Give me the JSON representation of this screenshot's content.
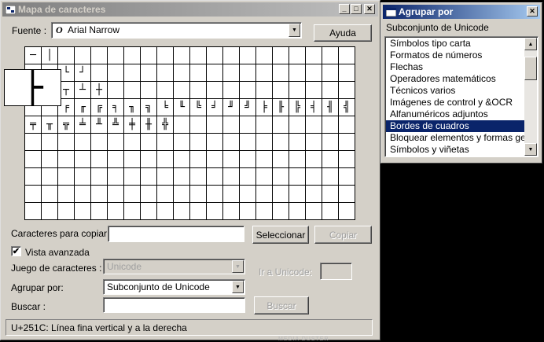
{
  "charmap": {
    "title": "Mapa de caracteres",
    "font_label": "Fuente :",
    "font_value": "Arial Narrow",
    "font_icon": "O",
    "help_button": "Ayuda",
    "zoom_char": "├",
    "grid_chars": [
      "─",
      "│",
      "",
      "",
      "",
      "",
      "",
      "",
      "",
      "",
      "",
      "",
      "",
      "",
      "",
      "",
      "",
      "",
      "",
      "",
      "",
      "",
      "└",
      "┘",
      "",
      "",
      "",
      "",
      "",
      "",
      "",
      "",
      "",
      "",
      "",
      "",
      "",
      "",
      "",
      "",
      "",
      "",
      "┬",
      "┴",
      "┼",
      "",
      "",
      "",
      "",
      "",
      "",
      "",
      "",
      "",
      "",
      "",
      "",
      "",
      "",
      "",
      "",
      "",
      "╒",
      "╓",
      "╔",
      "╕",
      "╖",
      "╗",
      "╘",
      "╙",
      "╚",
      "╛",
      "╜",
      "╝",
      "╞",
      "╟",
      "╠",
      "╡",
      "╢",
      "╣",
      "╤",
      "╥",
      "╦",
      "╧",
      "╨",
      "╩",
      "╪",
      "╫",
      "╬",
      "",
      "",
      "",
      "",
      "",
      "",
      "",
      "",
      "",
      "",
      "",
      "",
      "",
      "",
      "",
      "",
      "",
      "",
      "",
      "",
      "",
      "",
      "",
      "",
      "",
      "",
      "",
      "",
      "",
      "",
      "",
      "",
      "",
      "",
      "",
      "",
      "",
      "",
      "",
      "",
      "",
      "",
      "",
      "",
      "",
      "",
      "",
      "",
      "",
      "",
      "",
      "",
      "",
      "",
      "",
      "",
      "",
      "",
      "",
      "",
      "",
      "",
      "",
      "",
      "",
      "",
      "",
      "",
      "",
      "",
      "",
      "",
      "",
      "",
      "",
      "",
      "",
      "",
      "",
      "",
      "",
      "",
      "",
      "",
      "",
      "",
      "",
      "",
      "",
      "",
      "",
      "",
      "",
      "",
      "",
      "",
      "",
      "",
      "",
      "",
      "",
      "",
      "",
      "",
      "",
      "",
      "",
      "",
      "",
      "",
      ""
    ],
    "copy_label": "Caracteres para copiar :",
    "copy_value": "",
    "select_button": "Seleccionar",
    "copy_button": "Copiar",
    "advanced_view_label": "Vista avanzada",
    "advanced_view_checked": "✔",
    "charset_label": "Juego de caracteres :",
    "charset_value": "Unicode",
    "goto_unicode_label": "Ir a Unicode:",
    "goto_unicode_value": "",
    "group_by_label": "Agrupar por:",
    "group_by_value": "Subconjunto de Unicode",
    "search_label": "Buscar :",
    "search_value": "",
    "search_button": "Buscar",
    "status_text": "U+251C: Línea fina vertical y a la derecha"
  },
  "groupby": {
    "title": "Agrupar por",
    "subtitle": "Subconjunto de Unicode",
    "items": [
      {
        "label": "Símbolos tipo carta",
        "selected": false
      },
      {
        "label": "Formatos de números",
        "selected": false
      },
      {
        "label": "Flechas",
        "selected": false
      },
      {
        "label": "Operadores matemáticos",
        "selected": false
      },
      {
        "label": "Técnicos varios",
        "selected": false
      },
      {
        "label": "Imágenes de control y &OCR",
        "selected": false
      },
      {
        "label": "Alfanuméricos adjuntos",
        "selected": false
      },
      {
        "label": "Bordes de cuadros",
        "selected": true
      },
      {
        "label": "Bloquear elementos y formas ge",
        "selected": false
      },
      {
        "label": "Símbolos y viñetas",
        "selected": false
      }
    ],
    "close_button": "✕"
  },
  "desktop": {
    "bottom_text": "MEDIA DUSTER"
  },
  "colors": {
    "window_bg": "#d4d0c8",
    "selection": "#0a246a",
    "desktop": "#000000"
  }
}
